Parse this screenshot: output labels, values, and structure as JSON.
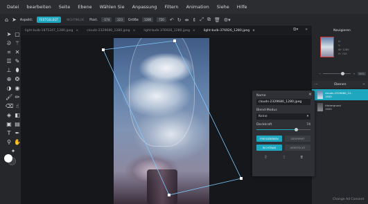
{
  "menu": [
    "Datei",
    "bearbeiten",
    "Seite",
    "Ebene",
    "Wählen Sie",
    "Anpassung",
    "Filtern",
    "Animation",
    "Siehe",
    "Hilfe"
  ],
  "options": {
    "aspect_label": "Aspekt:",
    "fixed": "FESTGELEGT",
    "non_fixed": "NICHTIMLOK",
    "pos_label": "Post.",
    "pos_x": "-174",
    "pos_y": "223",
    "size_label": "Größe",
    "size_w": "1280",
    "size_h": "720"
  },
  "tabs": [
    "light-bulb-1875247_1280.jpeg",
    "clouds-2329680_1280.jpeg",
    "light-bulb-376926_1280.jpeg",
    "light-bulb-376926_1280.jpeg"
  ],
  "navigator": {
    "title": "Navigieren",
    "info": [
      "X:",
      "Y:",
      "W: 1280",
      "H: 720"
    ],
    "zoom": "50%"
  },
  "layers": {
    "title": "Ebenen",
    "items": [
      {
        "name": "clouds-2329680_12..",
        "sub": "1920"
      },
      {
        "name": "Hintergrund",
        "sub": "1920"
      }
    ]
  },
  "popup": {
    "name_label": "Name",
    "name_value": "clouds-2329680_1280.jpeg",
    "blend_label": "Blend-Modus",
    "blend_value": "Keine",
    "opacity_label": "Deckkraft",
    "opacity_value": "74",
    "opacity_fraction": 0.74,
    "unlock": "FREIGEBEBEN",
    "lock": "GESPERRT",
    "visible": "SICHTBAR",
    "hidden": "VERSTECKT"
  },
  "watermark": "Change Ad Consent",
  "colors": {
    "accent": "#1fa7bf",
    "panel": "#25272b",
    "background": "#16171a"
  }
}
